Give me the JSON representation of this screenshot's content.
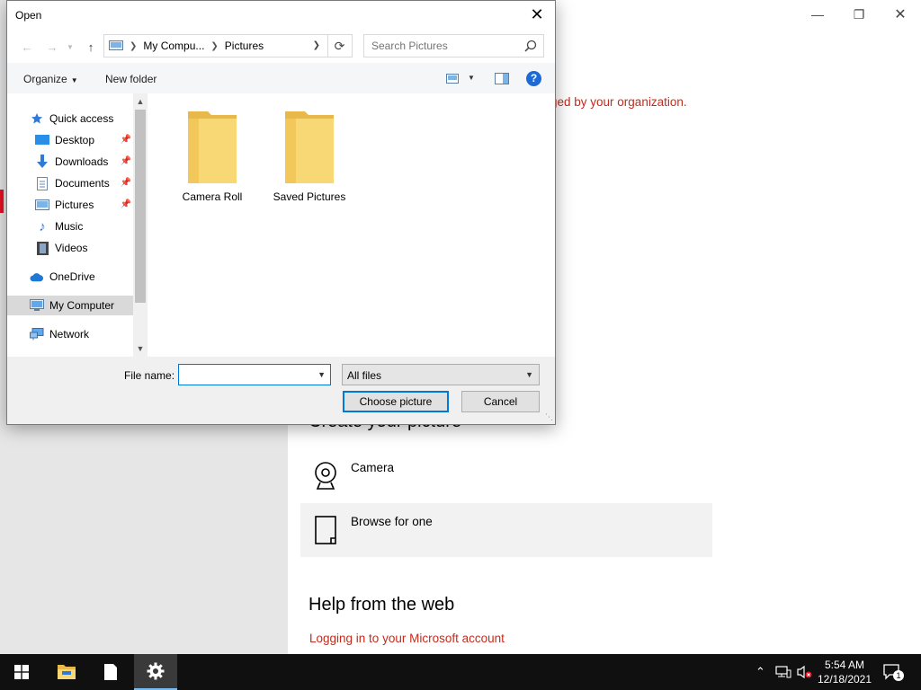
{
  "settings": {
    "org_message": "ged by your organization.",
    "create_heading": "Create your picture",
    "camera_label": "Camera",
    "browse_label": "Browse for one",
    "help_heading": "Help from the web",
    "help_link": "Logging in to your Microsoft account"
  },
  "dialog": {
    "title": "Open",
    "address": {
      "segments": [
        "My Compu...",
        "Pictures"
      ]
    },
    "search_placeholder": "Search Pictures",
    "toolbar": {
      "organize": "Organize",
      "new_folder": "New folder"
    },
    "nav": {
      "quick_access": "Quick access",
      "desktop": "Desktop",
      "downloads": "Downloads",
      "documents": "Documents",
      "pictures": "Pictures",
      "music": "Music",
      "videos": "Videos",
      "onedrive": "OneDrive",
      "my_computer": "My Computer",
      "network": "Network"
    },
    "folders": [
      "Camera Roll",
      "Saved Pictures"
    ],
    "file_name_label": "File name:",
    "file_name_value": "",
    "file_type": "All files",
    "choose_button": "Choose picture",
    "cancel_button": "Cancel"
  },
  "taskbar": {
    "time": "5:54 AM",
    "date": "12/18/2021",
    "notification_count": "1"
  },
  "colors": {
    "accent_red": "#c42b1c",
    "selection_blue": "#0078d7"
  }
}
